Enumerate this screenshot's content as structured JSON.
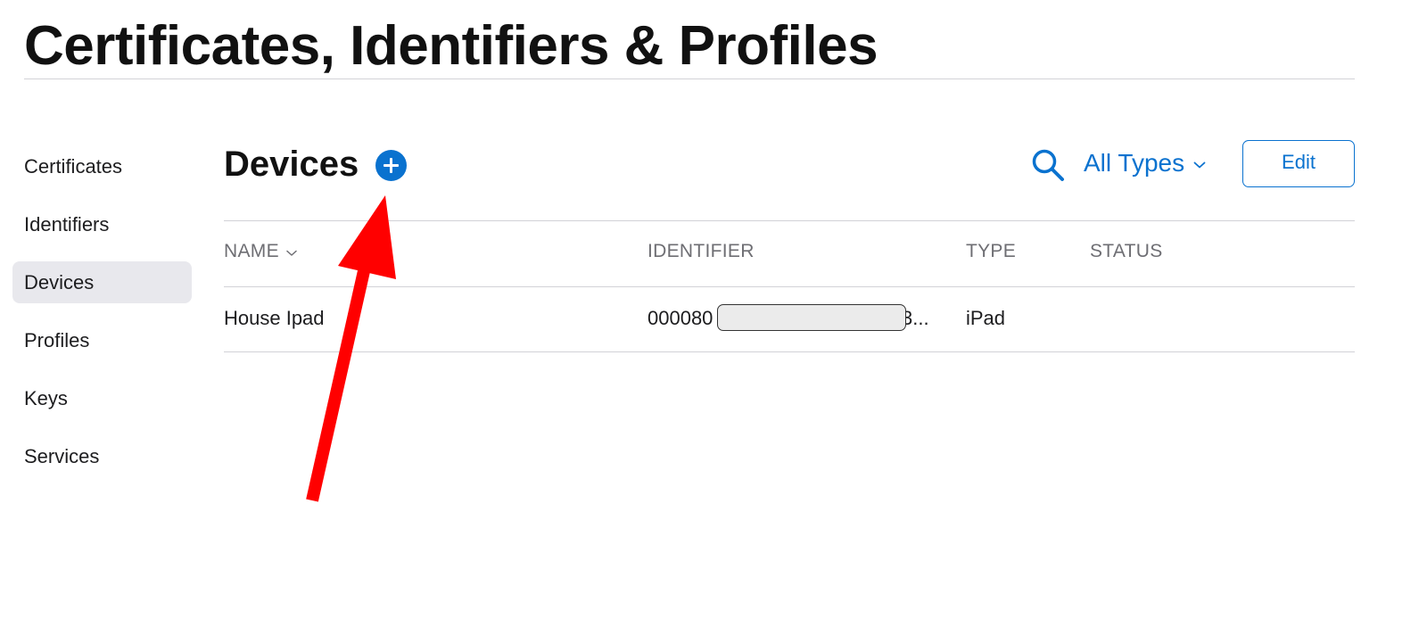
{
  "page": {
    "title": "Certificates, Identifiers & Profiles"
  },
  "sidebar": {
    "items": [
      {
        "label": "Certificates",
        "active": false
      },
      {
        "label": "Identifiers",
        "active": false
      },
      {
        "label": "Devices",
        "active": true
      },
      {
        "label": "Profiles",
        "active": false
      },
      {
        "label": "Keys",
        "active": false
      },
      {
        "label": "Services",
        "active": false
      }
    ]
  },
  "main": {
    "section_title": "Devices",
    "add_icon": "plus-circle-icon",
    "search_icon": "search-icon",
    "filter": {
      "selected": "All Types",
      "icon": "chevron-down-icon"
    },
    "edit_label": "Edit"
  },
  "table": {
    "columns": [
      "NAME",
      "IDENTIFIER",
      "TYPE",
      "STATUS"
    ],
    "sort_icon": "chevron-down-icon",
    "rows": [
      {
        "name": "House Ipad",
        "identifier_prefix": "000080",
        "identifier_suffix": "3...",
        "identifier_redacted": true,
        "type": "iPad",
        "status": ""
      }
    ]
  },
  "annotation": {
    "icon": "red-arrow-icon",
    "color": "#ff0000"
  },
  "colors": {
    "accent": "#0a72cf",
    "text": "#1d1d1f",
    "muted": "#6e6e73",
    "divider": "#d2d2d7",
    "active_bg": "#e8e8ed"
  }
}
